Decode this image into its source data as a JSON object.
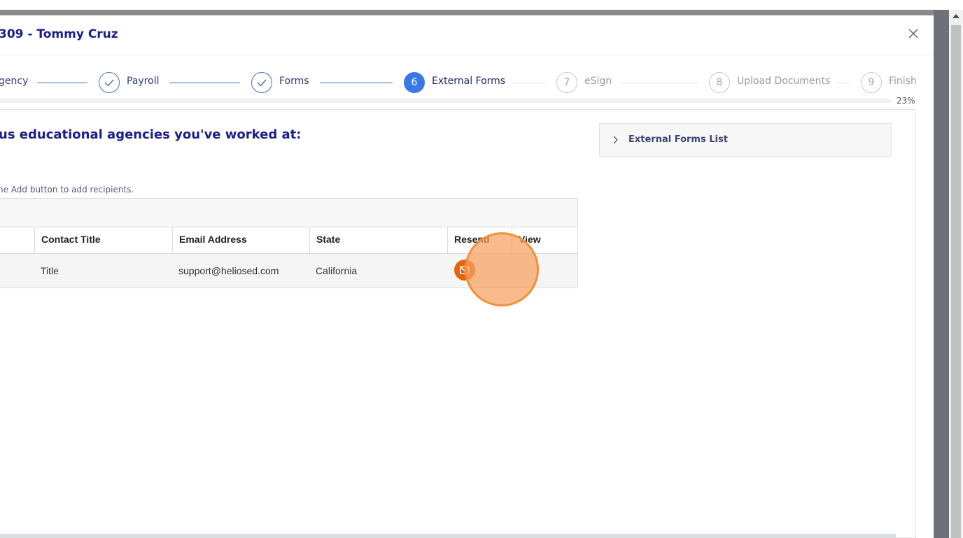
{
  "modal": {
    "title": "309 - Tommy Cruz",
    "close_icon": "close-icon"
  },
  "steps": [
    {
      "label": "gency",
      "status": "done"
    },
    {
      "label": "Payroll",
      "status": "done"
    },
    {
      "label": "Forms",
      "status": "done"
    },
    {
      "number": "6",
      "label": "External Forms",
      "status": "active"
    },
    {
      "number": "7",
      "label": "eSign",
      "status": "todo"
    },
    {
      "number": "8",
      "label": "Upload Documents",
      "status": "todo"
    },
    {
      "number": "9",
      "label": "Finish",
      "status": "todo"
    }
  ],
  "progress": {
    "percent": 23,
    "label": "23%"
  },
  "section": {
    "heading": "us educational agencies you've worked at:",
    "hint": "he Add button to add recipients."
  },
  "table": {
    "columns": [
      "Contact Title",
      "Email Address",
      "State",
      "Resend",
      "View"
    ],
    "rows": [
      {
        "contact_title": "Title",
        "email": "support@heliosed.com",
        "state": "California",
        "resend_icon": "mail-icon"
      }
    ]
  },
  "side_panel": {
    "label": "External Forms List",
    "icon": "chevron-right-icon"
  },
  "colors": {
    "accent": "#3b78e7",
    "title": "#1a1f8c",
    "resend": "#e8620f",
    "click_highlight": "#f6a05f"
  }
}
